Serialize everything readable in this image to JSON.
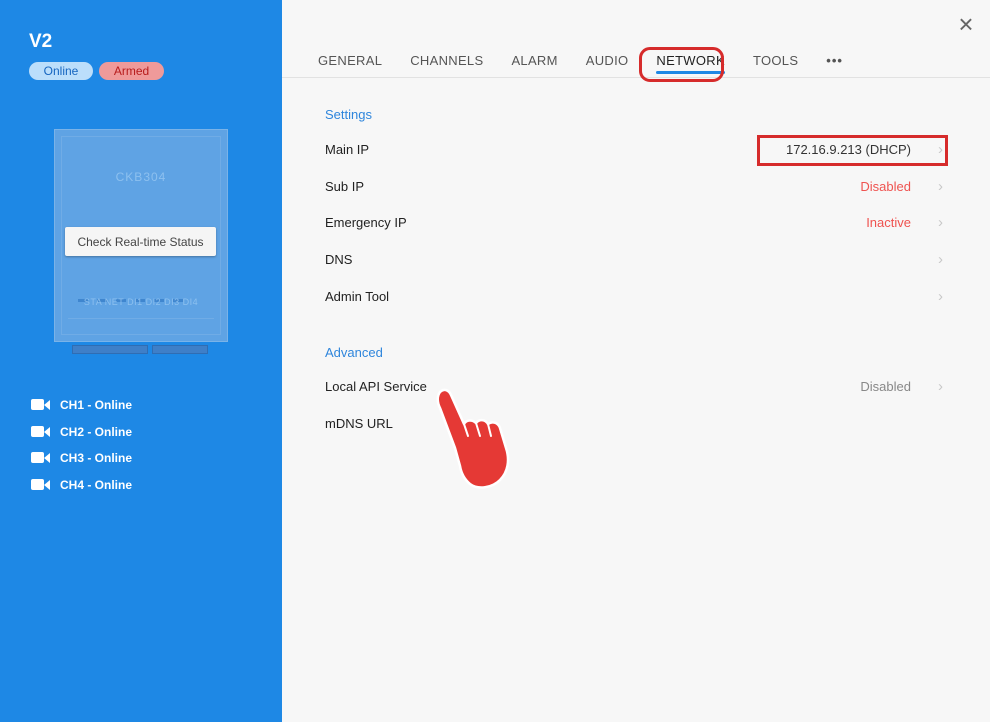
{
  "device": {
    "title": "V2",
    "status_online": "Online",
    "status_armed": "Armed",
    "model": "CKB304",
    "led_labels": "STA NET DI1 DI2 DI3 DI4",
    "check_button": "Check Real-time Status"
  },
  "channels": [
    {
      "label": "CH1 - Online",
      "icon": "video-camera-icon"
    },
    {
      "label": "CH2 - Online",
      "icon": "video-camera-icon"
    },
    {
      "label": "CH3 - Online",
      "icon": "video-camera-icon"
    },
    {
      "label": "CH4 - Online",
      "icon": "video-camera-icon"
    }
  ],
  "tabs": [
    {
      "label": "GENERAL"
    },
    {
      "label": "CHANNELS"
    },
    {
      "label": "ALARM"
    },
    {
      "label": "AUDIO"
    },
    {
      "label": "NETWORK",
      "active": true
    },
    {
      "label": "TOOLS"
    },
    {
      "label": "•••"
    }
  ],
  "sections": {
    "settings": {
      "title": "Settings",
      "rows": [
        {
          "label": "Main IP",
          "value": "172.16.9.213 (DHCP)",
          "value_color": "#333333"
        },
        {
          "label": "Sub IP",
          "value": "Disabled",
          "value_color": "#ef5350"
        },
        {
          "label": "Emergency IP",
          "value": "Inactive",
          "value_color": "#ef5350"
        },
        {
          "label": "DNS",
          "value": ""
        },
        {
          "label": "Admin Tool",
          "value": ""
        }
      ]
    },
    "advanced": {
      "title": "Advanced",
      "rows": [
        {
          "label": "Local API Service",
          "value": "Disabled",
          "value_color": "#888888"
        },
        {
          "label": "mDNS URL",
          "value": ""
        }
      ]
    }
  },
  "colors": {
    "sidebar": "#1e88e5",
    "accent": "#1e88e5",
    "annotation": "#d62b2b",
    "warning_text": "#ef5350"
  },
  "icons": {
    "close": "close-icon",
    "chevron": "chevron-right-icon",
    "pointer": "pointing-hand-icon"
  }
}
